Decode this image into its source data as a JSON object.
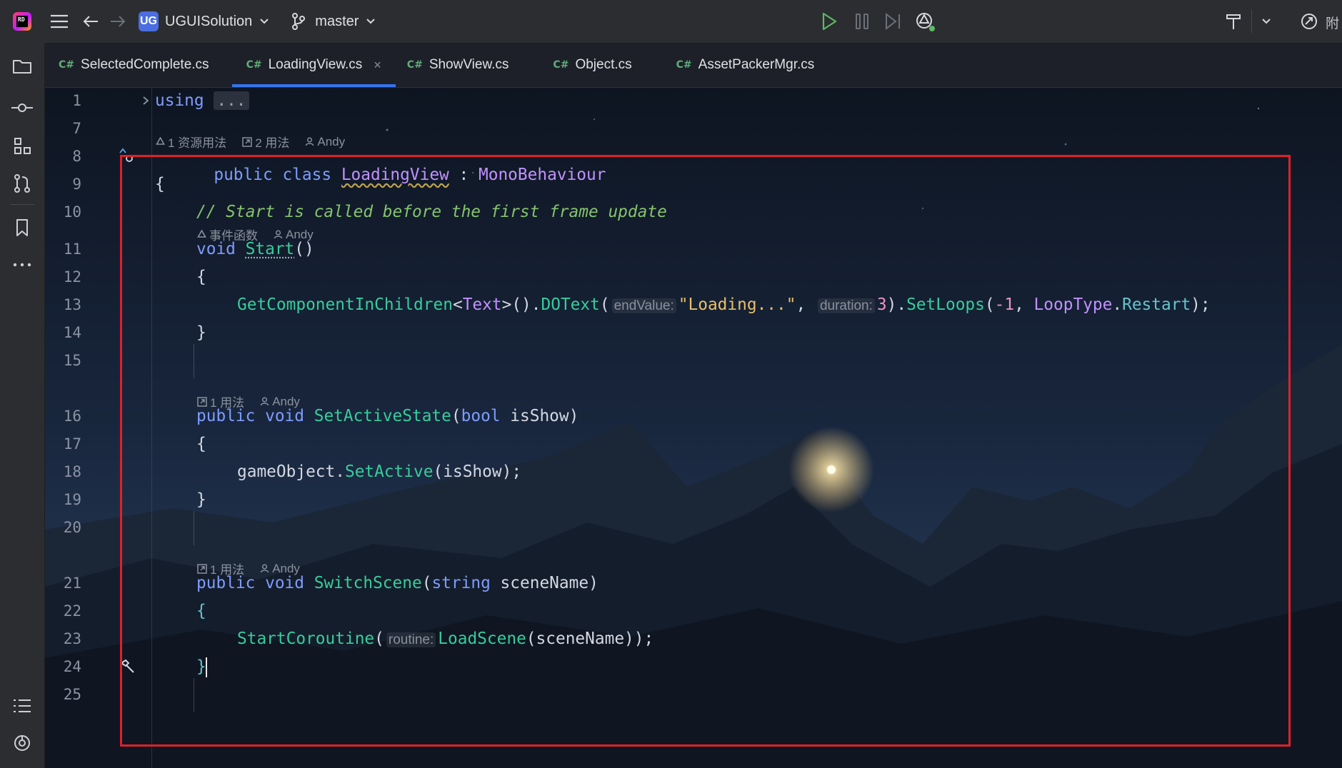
{
  "titlebar": {
    "project_badge": "UG",
    "project_name": "UGUISolution",
    "branch": "master",
    "right_cut_text": "附"
  },
  "tabs": [
    {
      "icon": "C#",
      "label": "SelectedComplete.cs",
      "active": false
    },
    {
      "icon": "C#",
      "label": "LoadingView.cs",
      "active": true,
      "close": "×"
    },
    {
      "icon": "C#",
      "label": "ShowView.cs",
      "active": false
    },
    {
      "icon": "C#",
      "label": "Object.cs",
      "active": false
    },
    {
      "icon": "C#",
      "label": "AssetPackerMgr.cs",
      "active": false
    }
  ],
  "hints": {
    "class": {
      "usages_assets": "1 资源用法",
      "usages": "2 用法",
      "author": "Andy"
    },
    "start": {
      "event": "事件函数",
      "author": "Andy"
    },
    "set_active": {
      "usages": "1 用法",
      "author": "Andy"
    },
    "switch_scene": {
      "usages": "1 用法",
      "author": "Andy"
    }
  },
  "code": {
    "l1_using": "using",
    "l1_fold": "...",
    "l8_public": "public",
    "l8_class": "class",
    "l8_name": "LoadingView",
    "l8_colon": ":",
    "l8_base": "MonoBehaviour",
    "l9": "{",
    "l10": "// Start is called before the first frame update",
    "l11_void": "void",
    "l11_name": "Start",
    "l11_paren": "()",
    "l12": "{",
    "l13_method": "GetComponentInChildren",
    "l13_generic_open": "<",
    "l13_type": "Text",
    "l13_generic_close": ">().",
    "l13_dotext": "DOText",
    "l13_open": "(",
    "l13_hint1": "endValue:",
    "l13_str": "\"Loading...\"",
    "l13_comma": ",",
    "l13_hint2": "duration:",
    "l13_num": "3",
    "l13_close1": ").",
    "l13_setloops": "SetLoops",
    "l13_open2": "(",
    "l13_neg": "-1",
    "l13_comma2": ",",
    "l13_enum_type": "LoopType",
    "l13_dot": ".",
    "l13_enum_val": "Restart",
    "l13_end": ");",
    "l14": "}",
    "l16_public": "public",
    "l16_void": "void",
    "l16_name": "SetActiveState",
    "l16_open": "(",
    "l16_type": "bool",
    "l16_param": "isShow)",
    "l17": "{",
    "l18_obj": "gameObject",
    "l18_dot": ".",
    "l18_method": "SetActive",
    "l18_args": "(isShow);",
    "l19": "}",
    "l21_public": "public",
    "l21_void": "void",
    "l21_name": "SwitchScene",
    "l21_open": "(",
    "l21_type": "string",
    "l21_param": "sceneName)",
    "l22": "{",
    "l23_method": "StartCoroutine",
    "l23_open": "(",
    "l23_hint": "routine:",
    "l23_inner": "LoadScene",
    "l23_args": "(sceneName));",
    "l24": "}"
  },
  "line_numbers": [
    "1",
    "7",
    "8",
    "9",
    "10",
    "11",
    "12",
    "13",
    "14",
    "15",
    "16",
    "17",
    "18",
    "19",
    "20",
    "21",
    "22",
    "23",
    "24",
    "25"
  ],
  "colors": {
    "keyword": "#7e9cfe",
    "class": "#c191ff",
    "method": "#39cc9b",
    "comment": "#85c46c",
    "string": "#e8bf6a",
    "highlight_box": "#e0202a",
    "tab_underline": "#3574f0"
  }
}
